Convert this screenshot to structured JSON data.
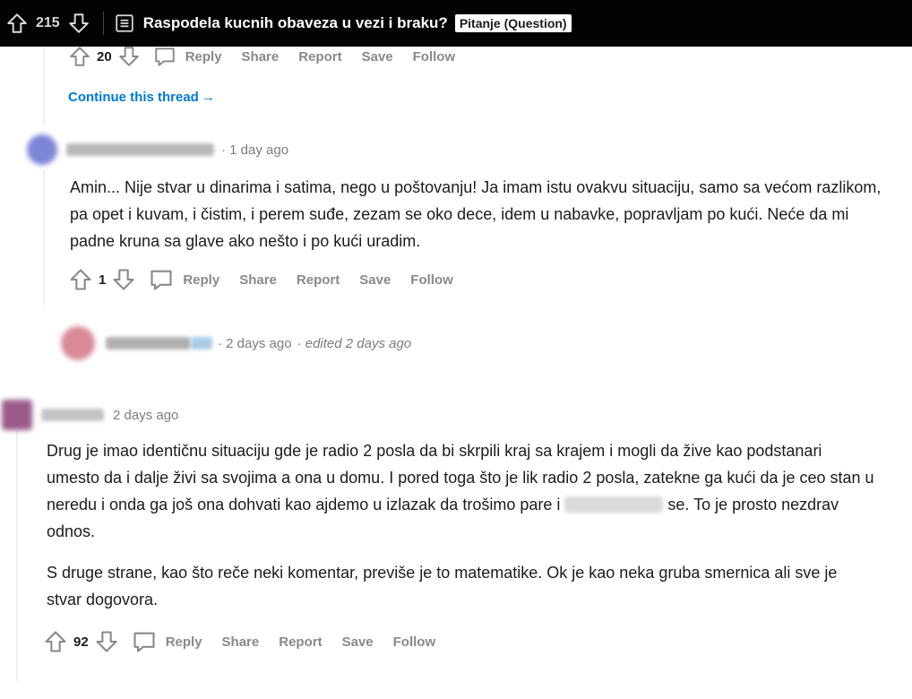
{
  "post_bar": {
    "score": "215",
    "title": "Raspodela kucnih obaveza u vezi i braku?",
    "flair": "Pitanje (Question)"
  },
  "labels": {
    "reply": "Reply",
    "share": "Share",
    "report": "Report",
    "save": "Save",
    "follow": "Follow"
  },
  "thread": {
    "prev_score": "20",
    "continue_label": "Continue this thread",
    "continue_arrow": "→"
  },
  "comments": [
    {
      "time": "· 1 day ago",
      "avatar_color": "#7d86d6",
      "score": "1",
      "body": "Amin... Nije stvar u dinarima i satima, nego u poštovanju! Ja imam istu ovakvu situaciju, samo sa većom razlikom, pa opet i kuvam, i čistim, i perem suđe, zezam se oko dece, idem u nabavke, popravljam po kući. Neće da mi padne kruna sa glave ako nešto i po kući uradim."
    },
    {
      "time": "· 2 days ago",
      "edited": "· edited 2 days ago",
      "avatar_color": "#d98a96"
    },
    {
      "time": "2 days ago",
      "avatar_color": "#9b5b8a",
      "score": "92",
      "body_p1_a": "Drug je imao identičnu situaciju gde je radio 2 posla da bi skrpili kraj sa krajem i mogli da žive kao podstanari umesto da i dalje živi sa svojima a ona u domu. I pored toga što je lik radio 2 posla, zatekne ga kući da je ceo stan u neredu i onda ga još ona dohvati kao ajdemo u izlazak da trošimo pare i",
      "body_p1_b": "se. To je prosto nezdrav odnos.",
      "body_p2": "S druge strane, kao što reče neki komentar, previše je to matematike. Ok je kao neka gruba smernica ali sve je stvar dogovora."
    }
  ],
  "icons": [
    "upvote-icon",
    "downvote-icon",
    "post-icon",
    "comment-icon",
    "arrow-right-icon"
  ]
}
